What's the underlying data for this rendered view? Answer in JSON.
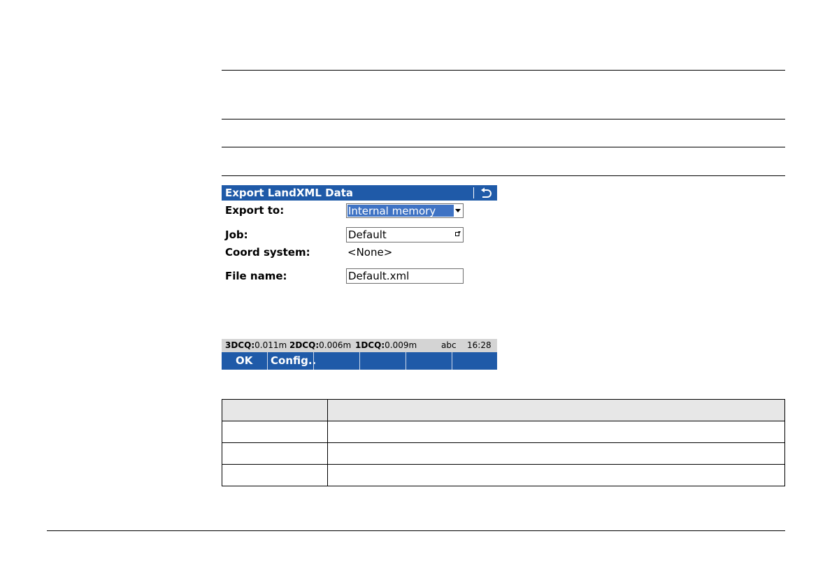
{
  "dialog": {
    "title": "Export LandXML Data",
    "rows": {
      "export_to": {
        "label": "Export to:",
        "value": "Internal memory"
      },
      "job": {
        "label": "Job:",
        "value": "Default"
      },
      "coord_system": {
        "label": "Coord system:",
        "value": "<None>"
      },
      "file_name": {
        "label": "File name:",
        "value": "Default.xml"
      }
    },
    "status": {
      "q3_label": "3DCQ:",
      "q3_value": "0.011m",
      "q2_label": "2DCQ:",
      "q2_value": "0.006m",
      "q1_label": "1DCQ:",
      "q1_value": "0.009m",
      "input_mode": "abc",
      "time": "16:28"
    },
    "softkeys": [
      "OK",
      "Config..",
      "",
      "",
      "",
      ""
    ],
    "colors": {
      "title_bar": "#1f5aa8",
      "selection": "#3f73c4",
      "status_bar": "#d4d4d4"
    }
  },
  "table": {
    "header": [
      "",
      ""
    ],
    "rows": [
      [
        "",
        ""
      ],
      [
        "",
        ""
      ],
      [
        "",
        ""
      ]
    ]
  }
}
